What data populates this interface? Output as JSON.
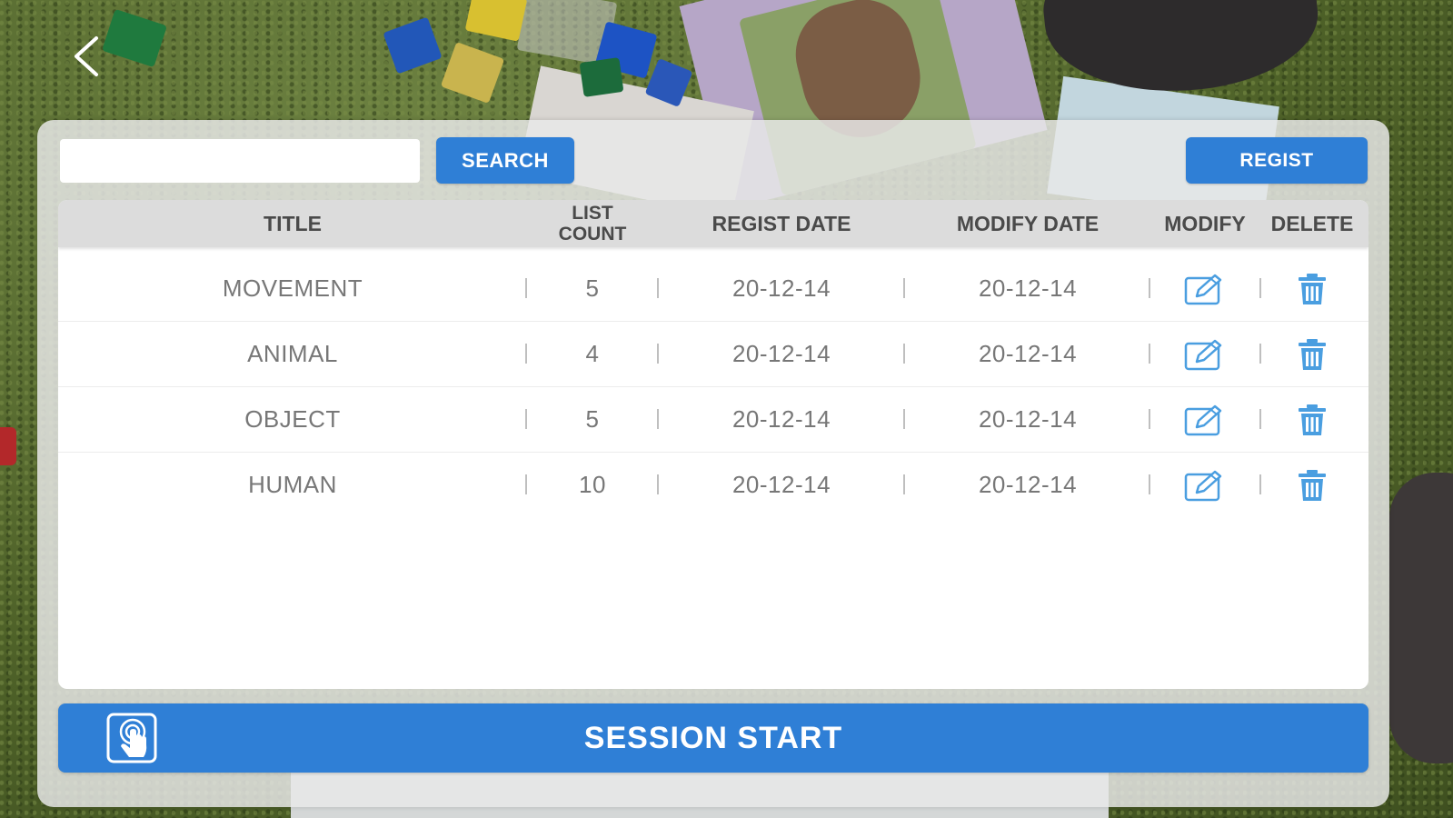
{
  "colors": {
    "accent": "#2f7fd6",
    "icon_blue": "#4a9ee0",
    "header_bg": "#dcdcdc",
    "panel_bg": "#e8e8e8"
  },
  "nav": {
    "back_icon": "chevron-left-icon"
  },
  "search": {
    "value": "",
    "placeholder": "",
    "button_label": "SEARCH"
  },
  "toolbar": {
    "regist_label": "REGIST"
  },
  "table": {
    "columns": {
      "title": "TITLE",
      "list_count": "LIST\nCOUNT",
      "regist_date": "REGIST DATE",
      "modify_date": "MODIFY DATE",
      "modify": "MODIFY",
      "delete": "DELETE"
    },
    "modify_icon": "edit-icon",
    "delete_icon": "trash-icon",
    "rows": [
      {
        "title": "MOVEMENT",
        "count": "5",
        "regist_date": "20-12-14",
        "modify_date": "20-12-14"
      },
      {
        "title": "ANIMAL",
        "count": "4",
        "regist_date": "20-12-14",
        "modify_date": "20-12-14"
      },
      {
        "title": "OBJECT",
        "count": "5",
        "regist_date": "20-12-14",
        "modify_date": "20-12-14"
      },
      {
        "title": "HUMAN",
        "count": "10",
        "regist_date": "20-12-14",
        "modify_date": "20-12-14"
      }
    ]
  },
  "session": {
    "label": "SESSION START",
    "icon": "touch-icon"
  }
}
